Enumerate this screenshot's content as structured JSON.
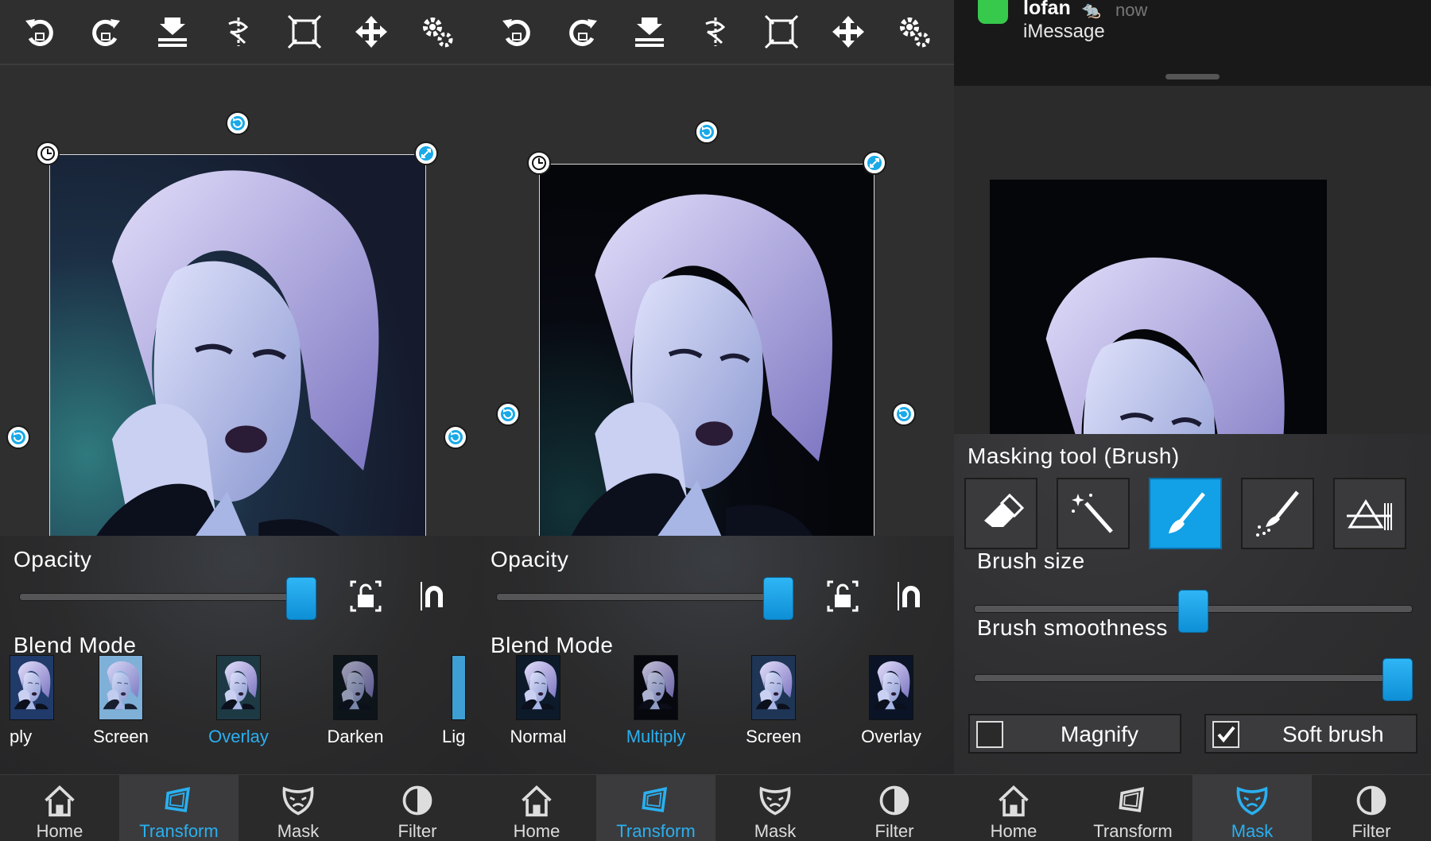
{
  "toolbar_icons": [
    "undo-icon",
    "redo-icon",
    "flatten-icon",
    "flip-icon",
    "fit-icon",
    "move-icon",
    "settings-icon"
  ],
  "opacity": {
    "label": "Opacity",
    "value_fraction": 1.0
  },
  "blend": {
    "label": "Blend Mode"
  },
  "panel1": {
    "blend_items": [
      {
        "label": "ply"
      },
      {
        "label": "Screen"
      },
      {
        "label": "Overlay",
        "selected": true
      },
      {
        "label": "Darken"
      },
      {
        "label": "Lig"
      }
    ]
  },
  "panel2": {
    "blend_items": [
      {
        "label": "Normal"
      },
      {
        "label": "Multiply",
        "selected": true
      },
      {
        "label": "Screen"
      },
      {
        "label": "Overlay"
      }
    ]
  },
  "nav": [
    {
      "label": "Home"
    },
    {
      "label": "Transform"
    },
    {
      "label": "Mask"
    },
    {
      "label": "Filter"
    }
  ],
  "notification": {
    "sender": "lofan",
    "time": "now",
    "app": "iMessage"
  },
  "masking": {
    "title": "Masking tool (Brush)",
    "tools": [
      "eraser-icon",
      "magic-wand-icon",
      "brush-icon",
      "spray-brush-icon",
      "gradient-icon"
    ],
    "active_tool": "brush-icon",
    "brush_size_label": "Brush size",
    "brush_size_fraction": 0.5,
    "brush_smoothness_label": "Brush smoothness",
    "brush_smoothness_fraction": 1.0,
    "magnify_label": "Magnify",
    "magnify_checked": false,
    "soft_brush_label": "Soft brush",
    "soft_brush_checked": true
  },
  "colors": {
    "accent": "#2ab0f0",
    "panel": "#2f2f30",
    "notification_green": "#36c94c"
  }
}
